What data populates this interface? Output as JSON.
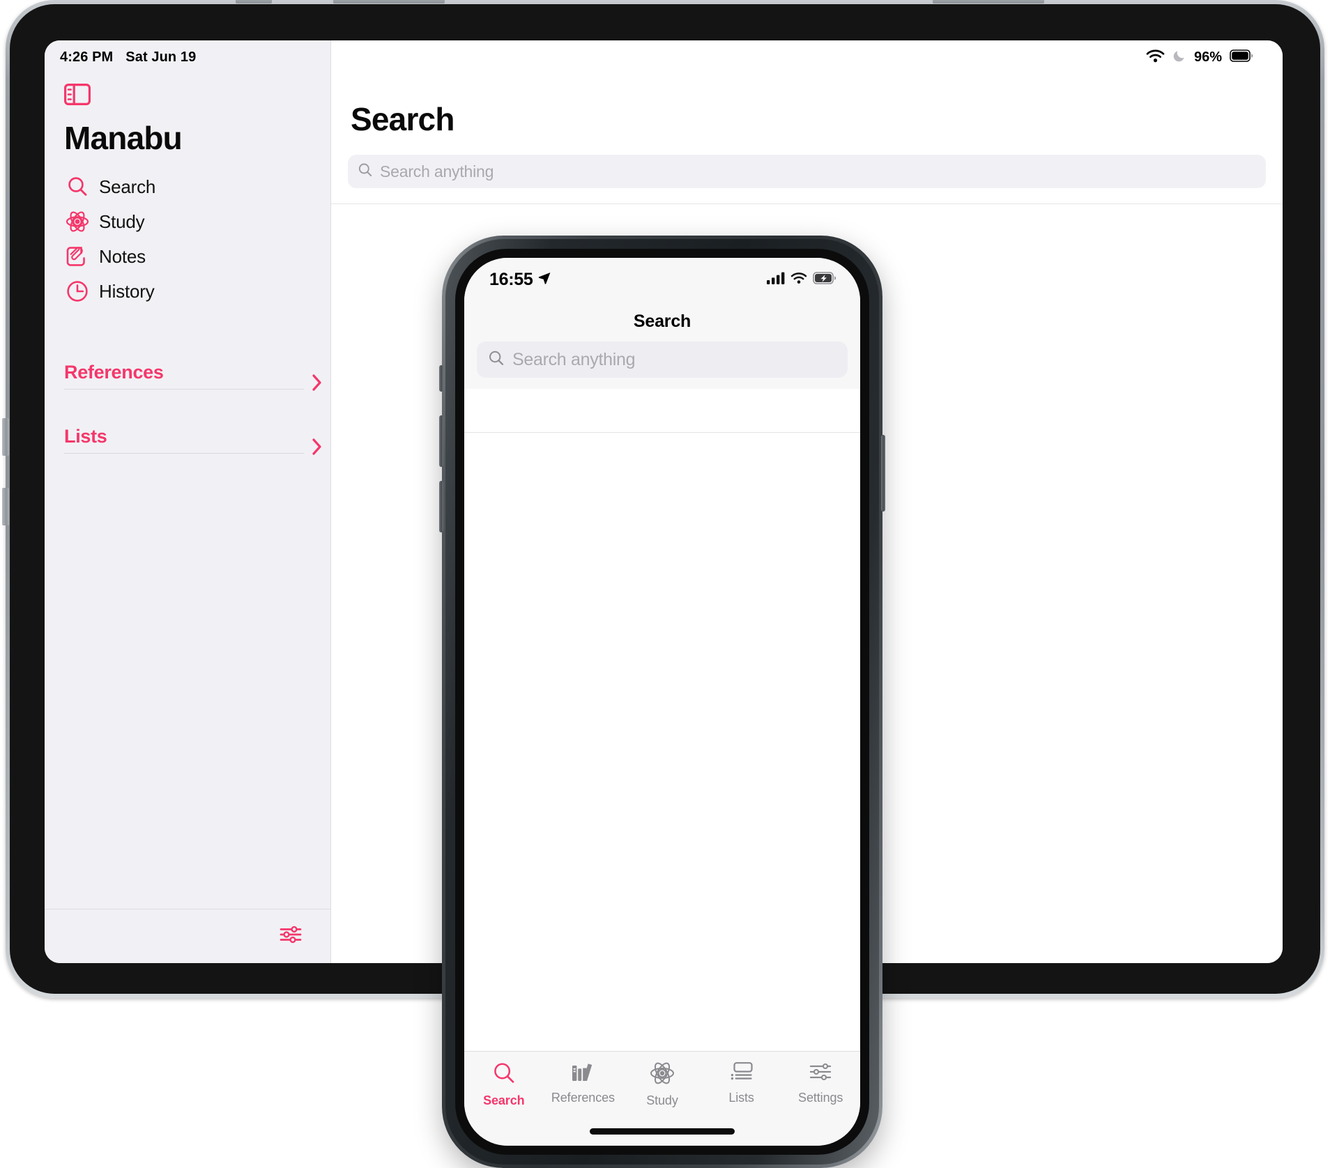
{
  "accent": "#f5376b",
  "ipad": {
    "status": {
      "time": "4:26 PM",
      "date": "Sat Jun 19",
      "battery_pct": "96%"
    },
    "sidebar": {
      "app_title": "Manabu",
      "toggle_icon": "sidebar-toggle-icon",
      "items": [
        {
          "label": "Search",
          "icon": "search-icon"
        },
        {
          "label": "Study",
          "icon": "atom-icon"
        },
        {
          "label": "Notes",
          "icon": "note-paperclip-icon"
        },
        {
          "label": "History",
          "icon": "clock-icon"
        }
      ],
      "groups": [
        {
          "label": "References",
          "chevron": "chevron-right-icon"
        },
        {
          "label": "Lists",
          "chevron": "chevron-right-icon"
        }
      ],
      "footer_icon": "sliders-settings-icon"
    },
    "detail": {
      "title": "Search",
      "search": {
        "placeholder": "Search anything",
        "value": "",
        "icon": "search-icon"
      }
    }
  },
  "iphone": {
    "status": {
      "time": "16:55",
      "location_icon": "location-arrow-icon",
      "cellular_icon": "cellular-bars-icon",
      "wifi_icon": "wifi-icon",
      "battery_icon": "battery-charging-icon"
    },
    "navbar": {
      "title": "Search"
    },
    "search": {
      "placeholder": "Search anything",
      "value": "",
      "icon": "search-icon"
    },
    "tabs": [
      {
        "label": "Search",
        "icon": "search-icon",
        "active": true
      },
      {
        "label": "References",
        "icon": "books-icon",
        "active": false
      },
      {
        "label": "Study",
        "icon": "atom-icon",
        "active": false
      },
      {
        "label": "Lists",
        "icon": "list-layout-icon",
        "active": false
      },
      {
        "label": "Settings",
        "icon": "sliders-settings-icon",
        "active": false
      }
    ]
  }
}
